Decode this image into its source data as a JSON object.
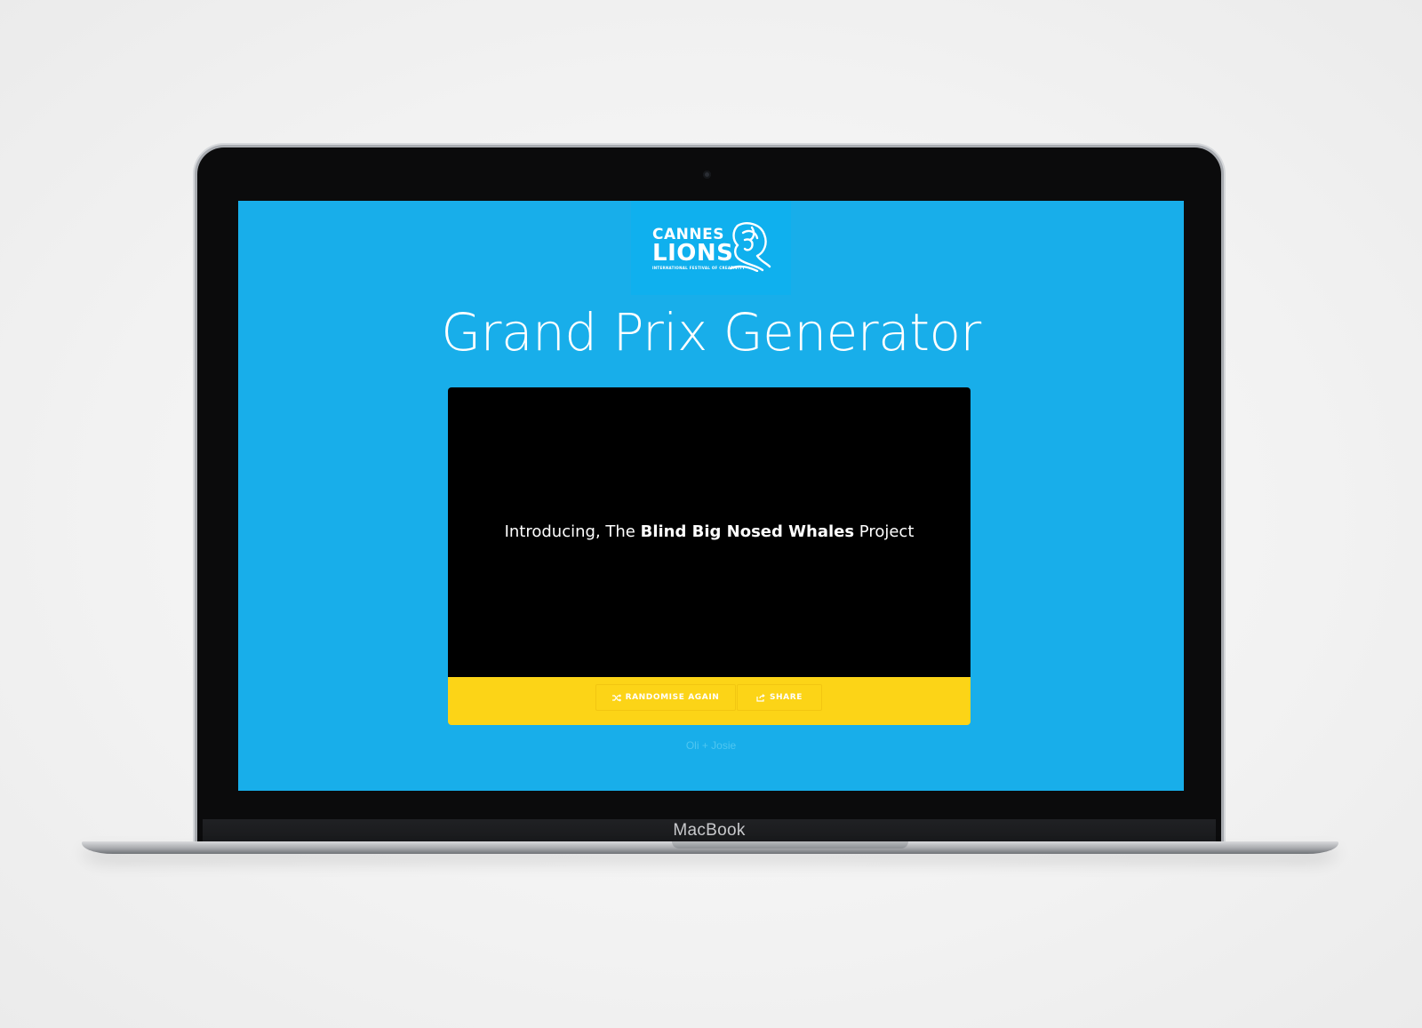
{
  "device": {
    "brand_label": "MacBook"
  },
  "logo": {
    "line1": "CANNES",
    "line2": "LIONS",
    "line3": "INTERNATIONAL FESTIVAL OF CREATIVITY"
  },
  "page": {
    "title": "Grand Prix Generator",
    "intro_prefix": "Introducing, The ",
    "intro_highlight": "Blind Big Nosed Whales",
    "intro_suffix": " Project",
    "credit": "Oli + Josie"
  },
  "buttons": {
    "randomise_label": "RANDOMISE AGAIN",
    "share_label": "SHARE"
  },
  "colors": {
    "background": "#18aeea",
    "card": "#000000",
    "footer_bar": "#fcd417",
    "text": "#ffffff"
  }
}
